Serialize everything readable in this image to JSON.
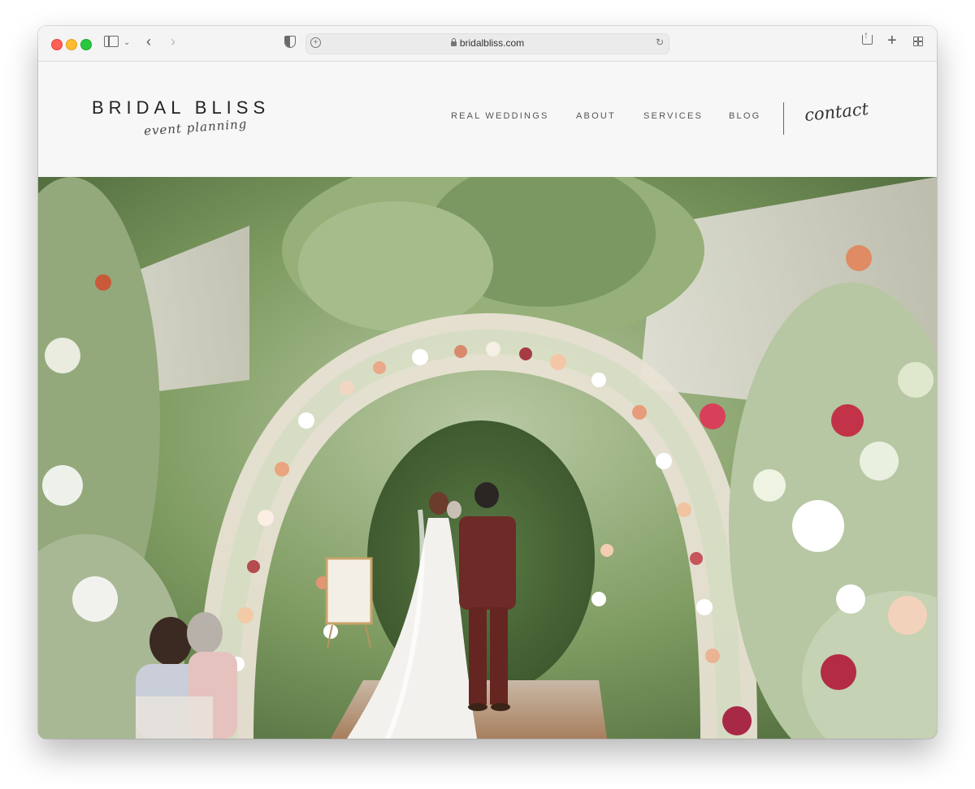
{
  "browser": {
    "url": "bridalbliss.com",
    "icons": [
      "sidebar-icon",
      "chevron-down-icon",
      "back-icon",
      "forward-icon",
      "shield-icon",
      "add-page-icon",
      "lock-icon",
      "reload-icon",
      "share-icon",
      "new-tab-icon",
      "tab-overview-icon"
    ]
  },
  "header": {
    "logo_title": "BRIDAL BLISS",
    "logo_subtitle": "event planning",
    "nav": [
      "REAL WEDDINGS",
      "ABOUT",
      "SERVICES",
      "BLOG"
    ],
    "contact": "contact"
  },
  "hero": {
    "slider_prev_icon": "chevron-left-icon",
    "scene": "garden wedding ceremony under floral arch"
  },
  "colors": {
    "header_bg": "#f7f7f7",
    "text_dark": "#222222",
    "suit_burgundy": "#6e2a26",
    "foliage_green": "#6f8f52"
  }
}
